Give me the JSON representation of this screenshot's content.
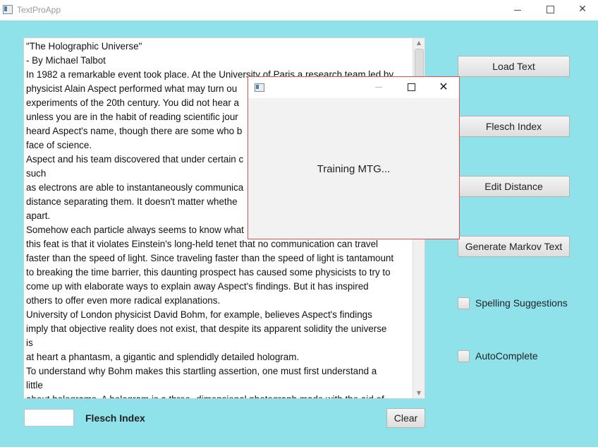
{
  "window": {
    "title": "TextProApp"
  },
  "text_area": {
    "lines": [
      "\"The Holographic Universe\"",
      "- By Michael Talbot",
      "In 1982 a remarkable event took place. At the University of Paris a research team led by",
      "physicist Alain Aspect performed what may turn ou",
      "experiments of the 20th century. You did not hear a",
      "unless you are in the habit of reading scientific jour",
      "heard Aspect's name, though there are some who b",
      "face of science.",
      "Aspect and his team discovered that under certain c",
      "such",
      "as electrons are able to instantaneously communica",
      "distance separating them. It doesn't matter whethe",
      "apart.",
      "Somehow each particle always seems to know what",
      "this feat is that it violates Einstein's long-held tenet that no communication can travel",
      "faster than the speed of light. Since traveling faster than the speed of light is tantamount",
      "to breaking the time barrier, this daunting prospect has caused some physicists to try to",
      "come up with elaborate ways to explain away Aspect's findings. But it has inspired",
      "others to offer even more radical explanations.",
      "University of London physicist David Bohm, for example, believes Aspect's findings",
      "imply that objective reality does not exist, that despite its apparent solidity the universe",
      "is",
      "at heart a phantasm, a gigantic and splendidly detailed hologram.",
      "To understand why Bohm makes this startling assertion, one must first understand a",
      "little",
      "about holograms. A hologram is a three- dimensional photograph made with the aid of"
    ]
  },
  "controls": {
    "flesch_label": "Flesch Index",
    "flesch_value": "",
    "clear_label": "Clear",
    "load_text_label": "Load Text",
    "flesch_index_label": "Flesch Index",
    "edit_distance_label": "Edit Distance",
    "generate_markov_label": "Generate Markov Text",
    "spelling_suggestions_label": "Spelling Suggestions",
    "autocomplete_label": "AutoComplete"
  },
  "dialog": {
    "message": "Training MTG..."
  }
}
